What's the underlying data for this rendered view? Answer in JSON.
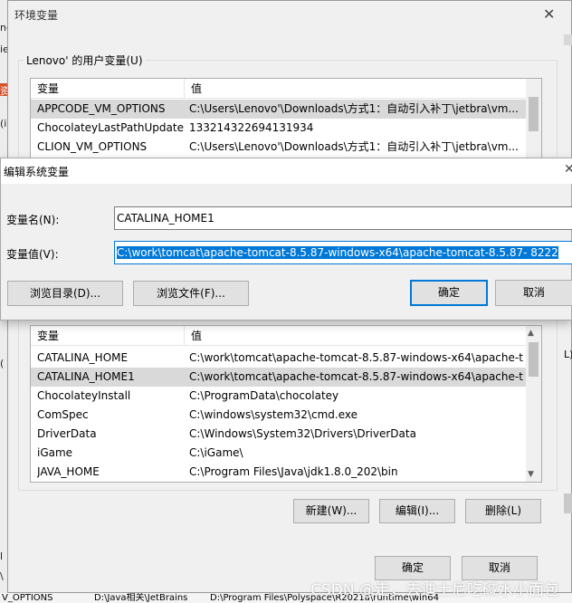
{
  "background": {
    "left_fragments": [
      "ne",
      "ie",
      "资",
      "(i",
      "(",
      "l",
      "\\",
      "V_OPTIONS"
    ],
    "bottom_fragments": [
      "D:\\Java相关\\JetBrains",
      "D:\\Program Files\\Polyspace\\R2021a\\runtime\\win64"
    ],
    "right_fragments": [
      "L)",
      "1"
    ]
  },
  "env_dialog": {
    "title": "环境变量",
    "close_glyph": "✕",
    "user_group_label": "Lenovo' 的用户变量(U)",
    "user_table": {
      "headers": [
        "变量",
        "值"
      ],
      "rows": [
        {
          "name": "APPCODE_VM_OPTIONS",
          "value": "C:\\Users\\Lenovo'\\Downloads\\方式1：自动引入补丁\\jetbra\\vm...",
          "selected": true
        },
        {
          "name": "ChocolateyLastPathUpdate",
          "value": "133214322694131934",
          "selected": false
        },
        {
          "name": "CLION_VM_OPTIONS",
          "value": "C:\\Users\\Lenovo'\\Downloads\\方式1：自动引入补丁\\jetbra\\vm...",
          "selected": false
        }
      ]
    },
    "system_table": {
      "headers": [
        "变量",
        "值"
      ],
      "rows": [
        {
          "name": "CATALINA_HOME",
          "value": "C:\\work\\tomcat\\apache-tomcat-8.5.87-windows-x64\\apache-t...",
          "selected": false
        },
        {
          "name": "CATALINA_HOME1",
          "value": "C:\\work\\tomcat\\apache-tomcat-8.5.87-windows-x64\\apache-t...",
          "selected": true
        },
        {
          "name": "ChocolateyInstall",
          "value": "C:\\ProgramData\\chocolatey",
          "selected": false
        },
        {
          "name": "ComSpec",
          "value": "C:\\windows\\system32\\cmd.exe",
          "selected": false
        },
        {
          "name": "DriverData",
          "value": "C:\\Windows\\System32\\Drivers\\DriverData",
          "selected": false
        },
        {
          "name": "iGame",
          "value": "C:\\iGame\\",
          "selected": false
        },
        {
          "name": "JAVA_HOME",
          "value": "C:\\Program Files\\Java\\jdk1.8.0_202\\bin",
          "selected": false
        }
      ]
    },
    "buttons": {
      "new": "新建(W)...",
      "edit": "编辑(I)...",
      "delete": "删除(L)",
      "ok": "确定",
      "cancel": "取消"
    }
  },
  "edit_dialog": {
    "title": "编辑系统变量",
    "close_glyph": "✕",
    "name_label": "变量名(N):",
    "value_label": "变量值(V):",
    "name_value": "CATALINA_HOME1",
    "value_value": "C:\\work\\tomcat\\apache-tomcat-8.5.87-windows-x64\\apache-tomcat-8.5.87- 8222",
    "buttons": {
      "browse_dir": "浏览目录(D)...",
      "browse_file": "浏览文件(F)...",
      "ok": "确定",
      "cancel": "取消"
    }
  },
  "watermark": "CSDN @走，去迪士尼吃碱水小面包",
  "colors": {
    "accent": "#0078d7",
    "selection_row": "#d9d9d9",
    "dialog_bg": "#f0f0f0"
  }
}
